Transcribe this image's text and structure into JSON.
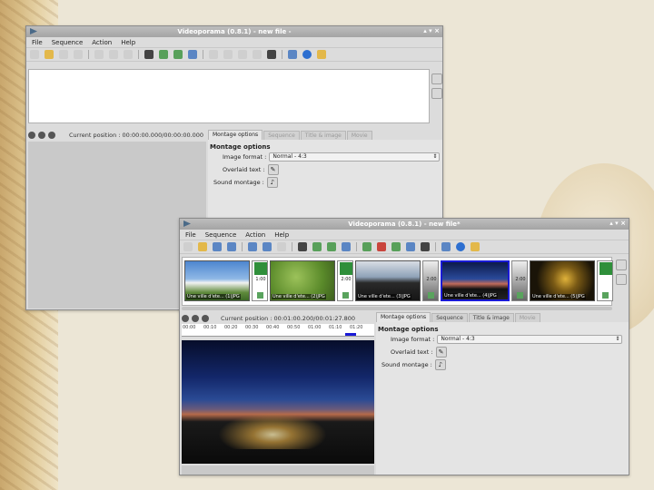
{
  "back_window": {
    "title": "Videoporama (0.8.1) - new file -",
    "menu": [
      "File",
      "Sequence",
      "Action",
      "Help"
    ],
    "position_label": "Current position : 00:00:00.000/00:00:00.000",
    "tabs": [
      "Montage options",
      "Sequence",
      "Title & image",
      "Movie"
    ],
    "options": {
      "title": "Montage options",
      "image_format_label": "Image format :",
      "image_format_value": "Normal - 4:3",
      "overlaid_text_label": "Overlaid text :",
      "sound_montage_label": "Sound montage :"
    },
    "controls": "▴ ▾ ×"
  },
  "front_window": {
    "title": "Videoporama (0.8.1) - new file*",
    "menu": [
      "File",
      "Sequence",
      "Action",
      "Help"
    ],
    "position_label": "Current position : 00:01:00.200/00:01:27.800",
    "tabs": [
      "Montage options",
      "Sequence",
      "Title & image",
      "Movie"
    ],
    "options": {
      "title": "Montage options",
      "image_format_label": "Image format :",
      "image_format_value": "Normal - 4:3",
      "overlaid_text_label": "Overlaid text :",
      "sound_montage_label": "Sound montage :"
    },
    "controls": "▴ ▾ ×",
    "thumbnails": [
      {
        "label": "Une ville d'ete... (1)JPG",
        "color": "#3b6fb2"
      },
      {
        "label": "Une ville d'ete... (2)JPG",
        "color": "#6d9a3a"
      },
      {
        "label": "Une ville d'ete... (3)JPG",
        "color": "#1f2a3a"
      },
      {
        "label": "Une ville d'ete... (4)JPG",
        "color": "#1a2f6a"
      },
      {
        "label": "Une ville d'ete... (5)JPG",
        "color": "#3a2a10"
      }
    ],
    "transitions": [
      "1:00",
      "2:00",
      "2:00",
      "2:00"
    ],
    "timeline_ticks": [
      "00:00",
      "00:10",
      "00:20",
      "00:30",
      "00:40",
      "00:50",
      "01:00",
      "01:10",
      "01:20"
    ]
  }
}
